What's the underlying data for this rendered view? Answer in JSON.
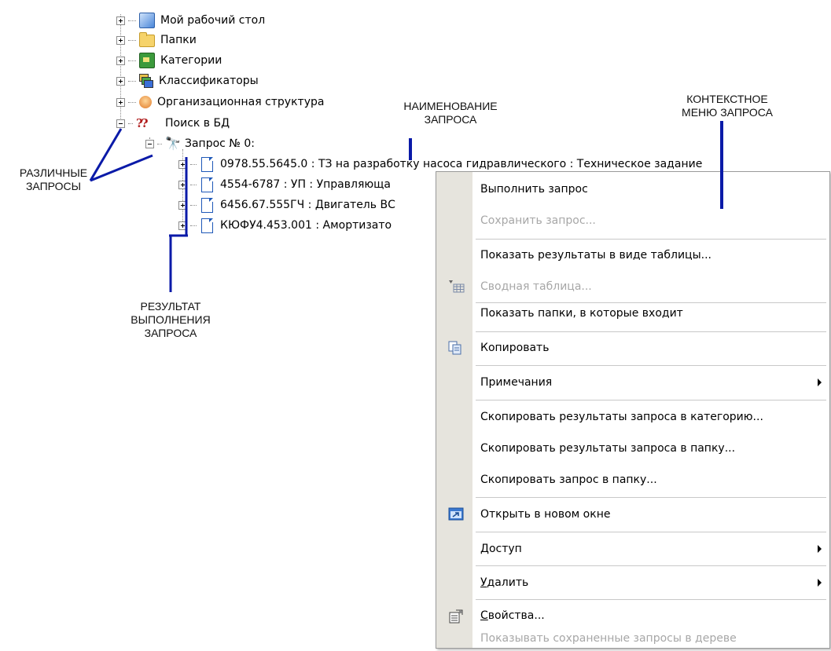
{
  "tree": {
    "items": [
      {
        "label": "Мой рабочий стол",
        "icon": "desktop-icon"
      },
      {
        "label": "Папки",
        "icon": "folder-icon"
      },
      {
        "label": "Категории",
        "icon": "categories-icon"
      },
      {
        "label": "Классификаторы",
        "icon": "classifiers-icon"
      },
      {
        "label": "Организационная структура",
        "icon": "org-structure-icon"
      },
      {
        "label": "Поиск в БД",
        "icon": "db-search-icon"
      }
    ],
    "query": {
      "label": "Запрос № 0:",
      "icon": "binoculars-icon"
    },
    "results": [
      {
        "label": "0978.55.5645.0 : ТЗ на разработку насоса гидравлического : Техническое задание"
      },
      {
        "label": "4554-6787 : УП : Управляюща"
      },
      {
        "label": "6456.67.555ГЧ : Двигатель ВС"
      },
      {
        "label": "КЮФУ4.453.001 : Амортизато"
      }
    ]
  },
  "annotations": {
    "query_name": [
      "НАИМЕНОВАНИЕ",
      "ЗАПРОСА"
    ],
    "context_menu": [
      "КОНТЕКСТНОЕ",
      "МЕНЮ ЗАПРОСА"
    ],
    "various_queries": [
      "РАЗЛИЧНЫЕ",
      "ЗАПРОСЫ"
    ],
    "query_result": [
      "РЕЗУЛЬТАТ",
      "ВЫПОЛНЕНИЯ",
      "ЗАПРОСА"
    ]
  },
  "menu": {
    "run": "Выполнить запрос",
    "save": "Сохранить запрос...",
    "show_table": "Показать результаты в виде таблицы...",
    "pivot": "Сводная таблица...",
    "show_folders": "Показать папки, в которые входит",
    "copy": "Копировать",
    "notes": "Примечания",
    "copy_to_category": "Скопировать результаты запроса в категорию...",
    "copy_to_folder": "Скопировать результаты запроса в папку...",
    "copy_query": "Скопировать запрос в папку...",
    "open_new": "Открыть в новом окне",
    "access": "Доступ",
    "delete_first": "У",
    "delete_rest": "далить",
    "props_first": "С",
    "props_rest": "войства...",
    "show_saved": "Показывать сохраненные запросы в дереве"
  },
  "colors": {
    "annotation_line": "#0a1aa8",
    "menu_gutter": "#e6e4dd",
    "disabled_text": "#a7a7a7"
  }
}
